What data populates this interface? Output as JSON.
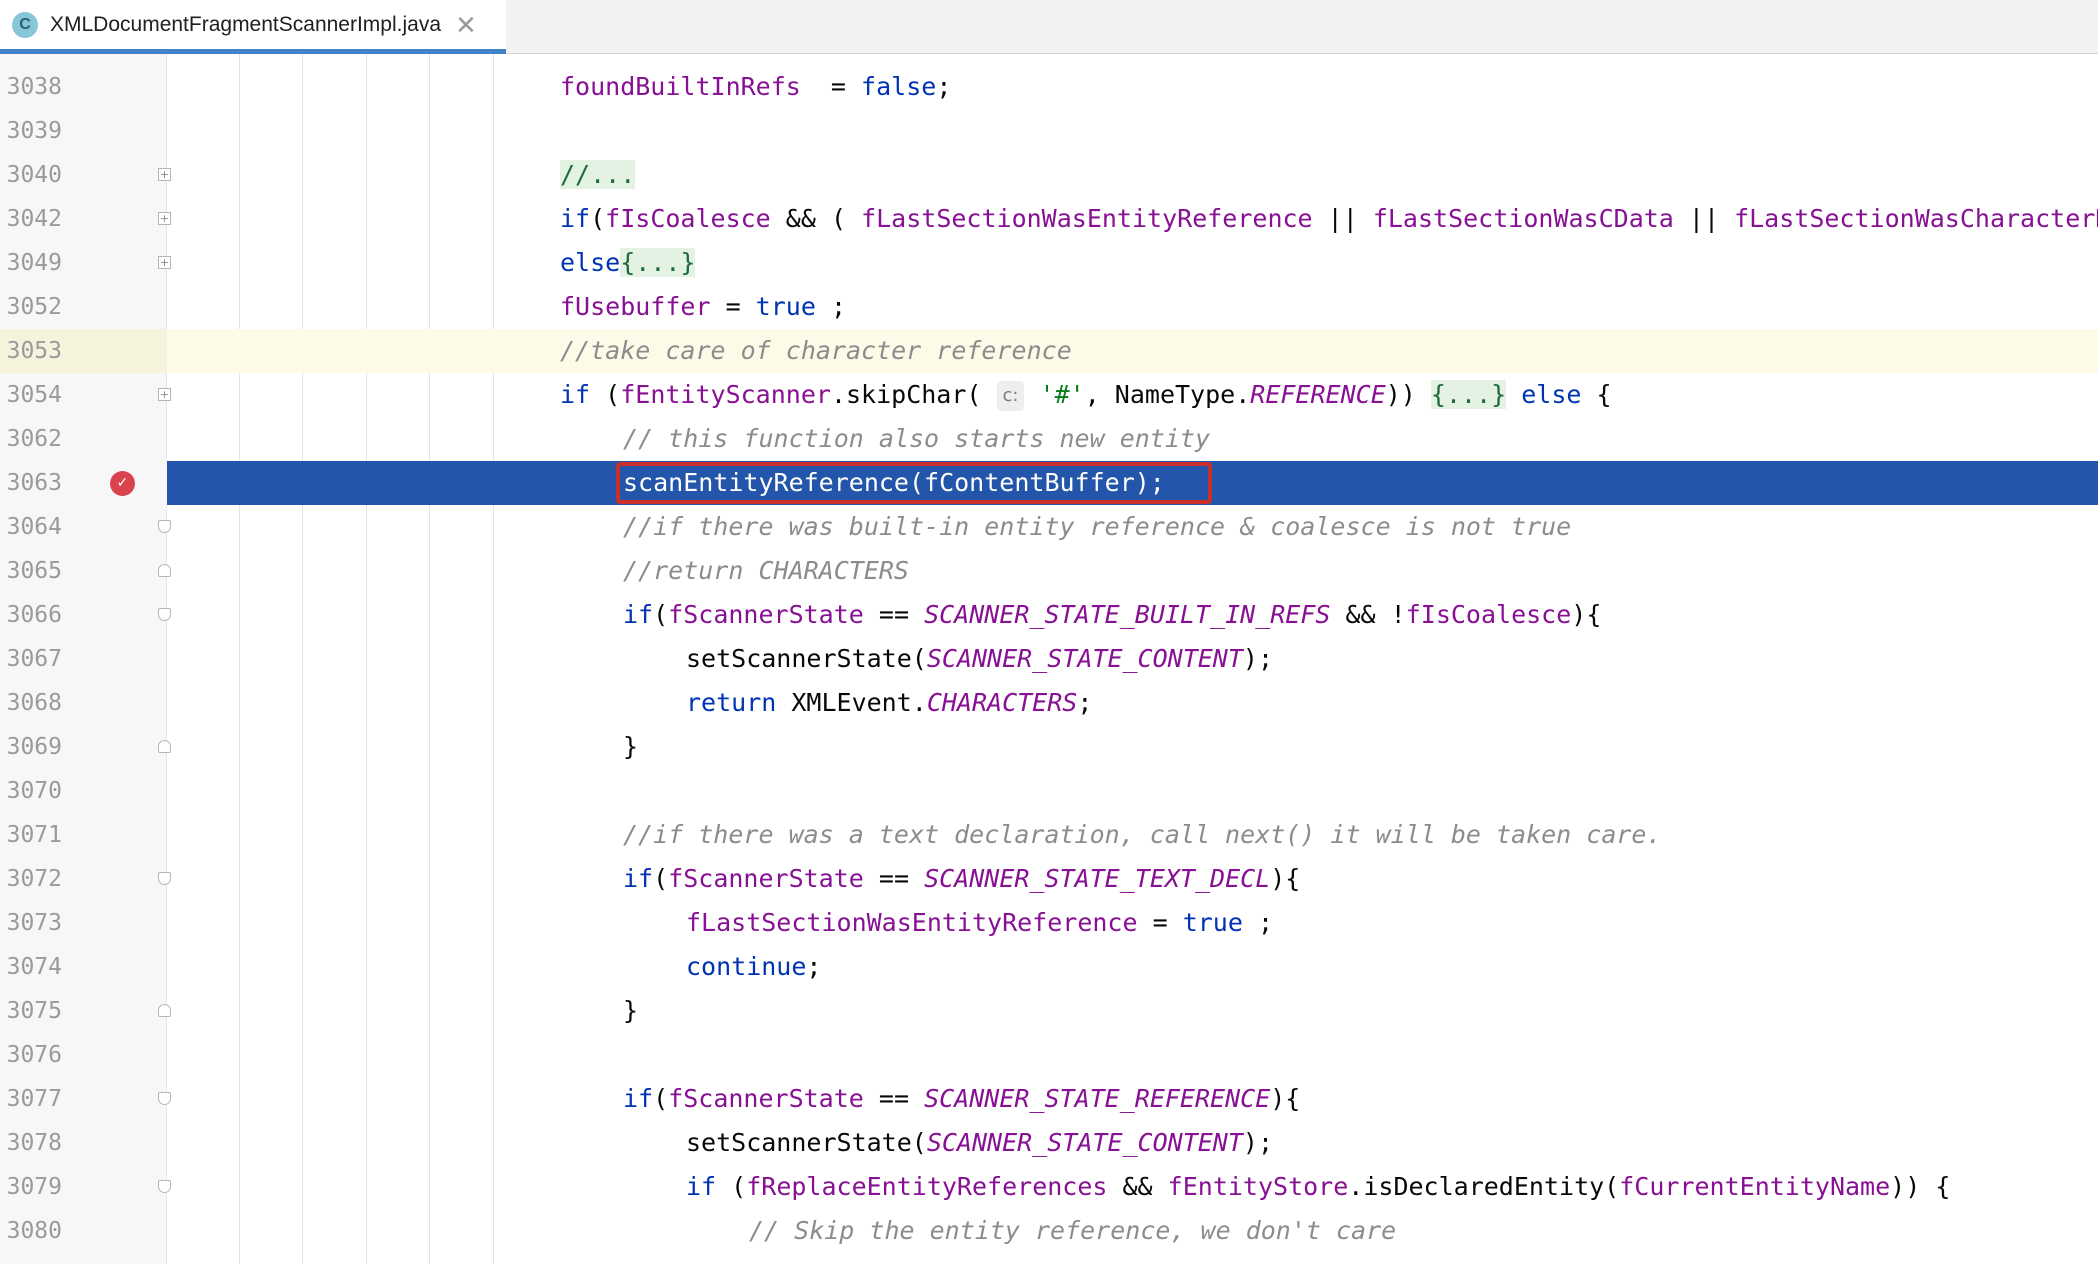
{
  "tab": {
    "icon_letter": "C",
    "title": "XMLDocumentFragmentScannerImpl.java",
    "close": "✕"
  },
  "lines": [
    {
      "num": "3038",
      "fold": "",
      "indent": 0,
      "tokens": [
        [
          "fld",
          "foundBuiltInRefs"
        ],
        [
          "",
          "  = "
        ],
        [
          "kw",
          "false"
        ],
        [
          "",
          ";"
        ]
      ]
    },
    {
      "num": "3039",
      "fold": "",
      "indent": 0,
      "tokens": []
    },
    {
      "num": "3040",
      "fold": "plus",
      "indent": 0,
      "tokens": [
        [
          "fb",
          "//..."
        ]
      ]
    },
    {
      "num": "3042",
      "fold": "plus",
      "indent": 0,
      "tokens": [
        [
          "kw",
          "if"
        ],
        [
          "",
          "("
        ],
        [
          "fld",
          "fIsCoalesce"
        ],
        [
          "",
          " && ( "
        ],
        [
          "fld",
          "fLastSectionWasEntityReference"
        ],
        [
          "",
          " || "
        ],
        [
          "fld",
          "fLastSectionWasCData"
        ],
        [
          "",
          " || "
        ],
        [
          "fld",
          "fLastSectionWasCharacterData"
        ]
      ]
    },
    {
      "num": "3049",
      "fold": "plus",
      "indent": 0,
      "tokens": [
        [
          "kw",
          "else"
        ],
        [
          "fb",
          "{...}"
        ]
      ]
    },
    {
      "num": "3052",
      "fold": "",
      "indent": 0,
      "tokens": [
        [
          "fld",
          "fUsebuffer"
        ],
        [
          "",
          " = "
        ],
        [
          "kw",
          "true"
        ],
        [
          "",
          " ;"
        ]
      ]
    },
    {
      "num": "3053",
      "fold": "",
      "indent": 0,
      "caret": true,
      "tokens": [
        [
          "cmt",
          "//take care of character reference"
        ]
      ]
    },
    {
      "num": "3054",
      "fold": "plus",
      "indent": 0,
      "tokens": [
        [
          "kw",
          "if"
        ],
        [
          "",
          " ("
        ],
        [
          "fld",
          "fEntityScanner"
        ],
        [
          "",
          ".skipChar( "
        ],
        [
          "hint",
          "c:"
        ],
        [
          "str",
          " '#'"
        ],
        [
          "",
          ", NameType."
        ],
        [
          "cst",
          "REFERENCE"
        ],
        [
          "",
          "))"
        ],
        [
          "",
          " "
        ],
        [
          "fb",
          "{...}"
        ],
        [
          "",
          " "
        ],
        [
          "kw",
          "else"
        ],
        [
          "",
          " {"
        ]
      ]
    },
    {
      "num": "3062",
      "fold": "",
      "indent": 1,
      "tokens": [
        [
          "cmt",
          "// this function also starts new entity"
        ]
      ]
    },
    {
      "num": "3063",
      "fold": "",
      "indent": 1,
      "selected": true,
      "breakpoint": true,
      "tokens": [
        [
          "",
          "scanEntityReference("
        ],
        [
          "fld",
          "fContentBuffer"
        ],
        [
          "",
          ");"
        ]
      ]
    },
    {
      "num": "3064",
      "fold": "start",
      "indent": 1,
      "tokens": [
        [
          "cmt",
          "//if there was built-in entity reference & coalesce is not true"
        ]
      ]
    },
    {
      "num": "3065",
      "fold": "end",
      "indent": 1,
      "tokens": [
        [
          "cmt",
          "//return CHARACTERS"
        ]
      ]
    },
    {
      "num": "3066",
      "fold": "start",
      "indent": 1,
      "tokens": [
        [
          "kw",
          "if"
        ],
        [
          "",
          "("
        ],
        [
          "fld",
          "fScannerState"
        ],
        [
          "",
          " == "
        ],
        [
          "cst",
          "SCANNER_STATE_BUILT_IN_REFS"
        ],
        [
          "",
          " && !"
        ],
        [
          "fld",
          "fIsCoalesce"
        ],
        [
          "",
          "){"
        ]
      ]
    },
    {
      "num": "3067",
      "fold": "",
      "indent": 2,
      "tokens": [
        [
          "",
          "setScannerState("
        ],
        [
          "cst",
          "SCANNER_STATE_CONTENT"
        ],
        [
          "",
          ");"
        ]
      ]
    },
    {
      "num": "3068",
      "fold": "",
      "indent": 2,
      "tokens": [
        [
          "kw",
          "return"
        ],
        [
          "",
          " XMLEvent."
        ],
        [
          "cst",
          "CHARACTERS"
        ],
        [
          "",
          ";"
        ]
      ]
    },
    {
      "num": "3069",
      "fold": "end",
      "indent": 1,
      "tokens": [
        [
          "",
          "}"
        ]
      ]
    },
    {
      "num": "3070",
      "fold": "",
      "indent": 1,
      "tokens": []
    },
    {
      "num": "3071",
      "fold": "",
      "indent": 1,
      "tokens": [
        [
          "cmt",
          "//if there was a text declaration, call next() it will be taken care."
        ]
      ]
    },
    {
      "num": "3072",
      "fold": "start",
      "indent": 1,
      "tokens": [
        [
          "kw",
          "if"
        ],
        [
          "",
          "("
        ],
        [
          "fld",
          "fScannerState"
        ],
        [
          "",
          " == "
        ],
        [
          "cst",
          "SCANNER_STATE_TEXT_DECL"
        ],
        [
          "",
          "){"
        ]
      ]
    },
    {
      "num": "3073",
      "fold": "",
      "indent": 2,
      "tokens": [
        [
          "fld",
          "fLastSectionWasEntityReference"
        ],
        [
          "",
          " = "
        ],
        [
          "kw",
          "true"
        ],
        [
          "",
          " ;"
        ]
      ]
    },
    {
      "num": "3074",
      "fold": "",
      "indent": 2,
      "tokens": [
        [
          "kw",
          "continue"
        ],
        [
          "",
          ";"
        ]
      ]
    },
    {
      "num": "3075",
      "fold": "end",
      "indent": 1,
      "tokens": [
        [
          "",
          "}"
        ]
      ]
    },
    {
      "num": "3076",
      "fold": "",
      "indent": 1,
      "tokens": []
    },
    {
      "num": "3077",
      "fold": "start",
      "indent": 1,
      "tokens": [
        [
          "kw",
          "if"
        ],
        [
          "",
          "("
        ],
        [
          "fld",
          "fScannerState"
        ],
        [
          "",
          " == "
        ],
        [
          "cst",
          "SCANNER_STATE_REFERENCE"
        ],
        [
          "",
          "){"
        ]
      ]
    },
    {
      "num": "3078",
      "fold": "",
      "indent": 2,
      "tokens": [
        [
          "",
          "setScannerState("
        ],
        [
          "cst",
          "SCANNER_STATE_CONTENT"
        ],
        [
          "",
          ");"
        ]
      ]
    },
    {
      "num": "3079",
      "fold": "start",
      "indent": 2,
      "tokens": [
        [
          "kw",
          "if"
        ],
        [
          "",
          " ("
        ],
        [
          "fld",
          "fReplaceEntityReferences"
        ],
        [
          "",
          " && "
        ],
        [
          "fld",
          "fEntityStore"
        ],
        [
          "",
          ".isDeclaredEntity("
        ],
        [
          "fld",
          "fCurrentEntityName"
        ],
        [
          "",
          ")) {"
        ]
      ]
    },
    {
      "num": "3080",
      "fold": "",
      "indent": 3,
      "tokens": [
        [
          "cmt",
          "// Skip the entity reference, we don't care"
        ]
      ]
    }
  ]
}
